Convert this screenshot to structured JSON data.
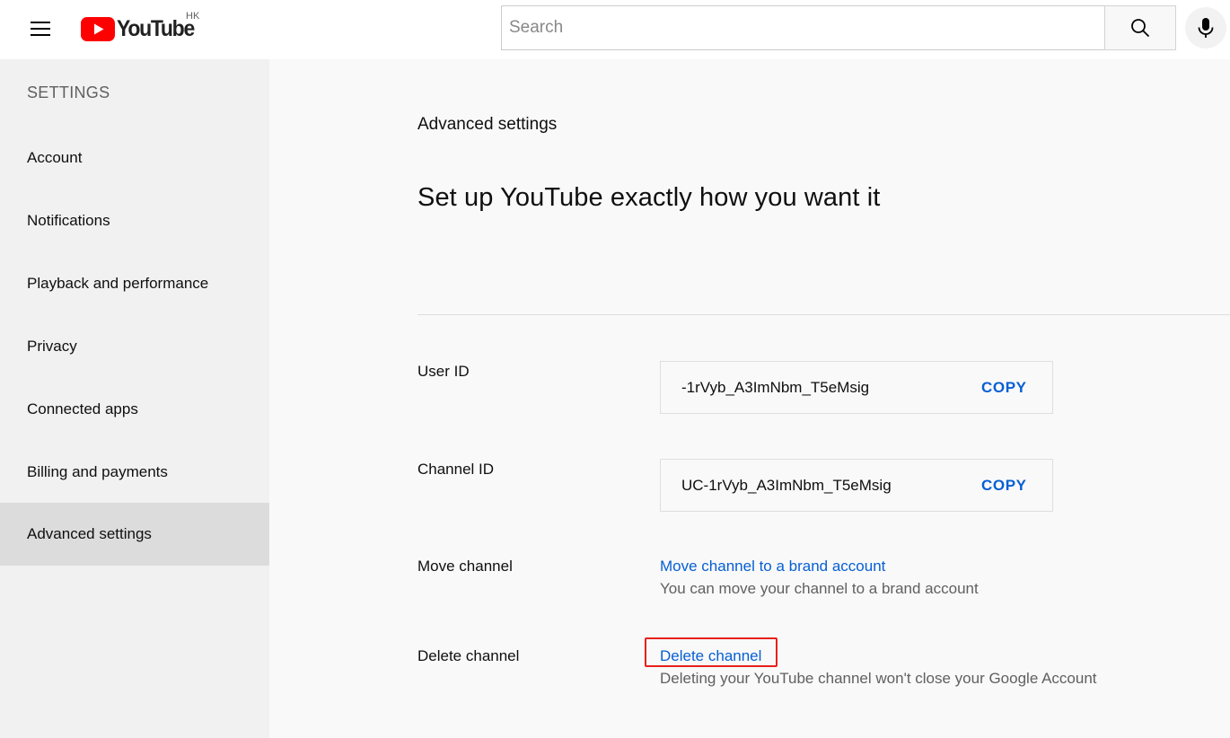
{
  "header": {
    "logo_text": "YouTube",
    "country_code": "HK",
    "search_placeholder": "Search",
    "icons": [
      "menu-icon",
      "youtube-logo-icon",
      "search-icon",
      "microphone-icon"
    ]
  },
  "sidebar": {
    "title": "SETTINGS",
    "items": [
      {
        "label": "Account",
        "active": false
      },
      {
        "label": "Notifications",
        "active": false
      },
      {
        "label": "Playback and performance",
        "active": false
      },
      {
        "label": "Privacy",
        "active": false
      },
      {
        "label": "Connected apps",
        "active": false
      },
      {
        "label": "Billing and payments",
        "active": false
      },
      {
        "label": "Advanced settings",
        "active": true
      }
    ]
  },
  "main": {
    "heading": "Advanced settings",
    "subtitle": "Set up YouTube exactly how you want it",
    "user_id": {
      "label": "User ID",
      "value": "-1rVyb_A3ImNbm_T5eMsig",
      "copy_label": "COPY"
    },
    "channel_id": {
      "label": "Channel ID",
      "value": "UC-1rVyb_A3ImNbm_T5eMsig",
      "copy_label": "COPY"
    },
    "move_channel": {
      "label": "Move channel",
      "link": "Move channel to a brand account",
      "description": "You can move your channel to a brand account"
    },
    "delete_channel": {
      "label": "Delete channel",
      "link": "Delete channel",
      "description": "Deleting your YouTube channel won't close your Google Account"
    }
  },
  "colors": {
    "brand_red": "#ff0000",
    "link_blue": "#065fd4",
    "highlight_red": "#e8211a",
    "sidebar_bg": "#f1f1f1",
    "sidebar_active_bg": "#dcdcdc"
  }
}
